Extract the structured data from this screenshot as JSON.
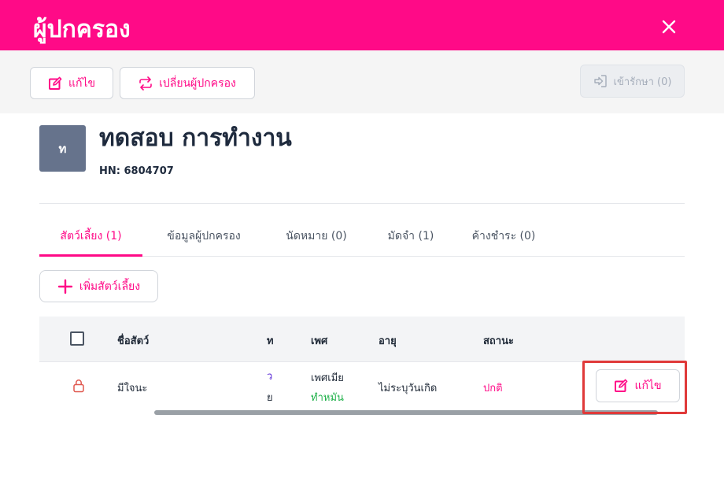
{
  "header": {
    "title": "ผู้ปกครอง",
    "close_icon": "close-icon"
  },
  "toolbar": {
    "edit_label": "แก้ไข",
    "change_owner_label": "เปลี่ยนผู้ปกครอง",
    "admit_label": "เข้ารักษา (0)"
  },
  "owner": {
    "avatar_initial": "ท",
    "name": "ทดสอบ การทำงาน",
    "hn": "HN: 6804707"
  },
  "tabs": [
    {
      "label": "สัตว์เลี้ยง (1)",
      "active": true
    },
    {
      "label": "ข้อมูลผู้ปกครอง",
      "active": false
    },
    {
      "label": "นัดหมาย (0)",
      "active": false
    },
    {
      "label": "มัดจำ (1)",
      "active": false
    },
    {
      "label": "ค้างชำระ (0)",
      "active": false
    }
  ],
  "add_pet_label": "เพิ่มสัตว์เลี้ยง",
  "table": {
    "columns": [
      "ชื่อสัตว์",
      "ท",
      "เพศ",
      "อายุ",
      "สถานะ"
    ],
    "rows": [
      {
        "name": "มีใจนะ",
        "type_line1": "ว",
        "type_line2": "ย",
        "sex": "เพศเมีย",
        "sterile": "ทำหมัน",
        "age": "ไม่ระบุวันเกิด",
        "status": "ปกติ",
        "edit_label": "แก้ไข"
      }
    ]
  },
  "colors": {
    "brand": "#ff0a87",
    "highlight": "#e03a3a",
    "lock": "#e0584f",
    "type_text": "#5b2bd6",
    "sterile": "#22b24c",
    "status_normal": "#ff0a87"
  }
}
